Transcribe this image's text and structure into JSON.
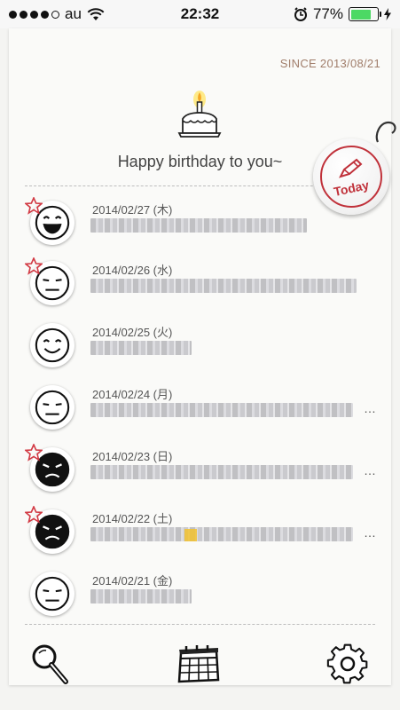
{
  "status_bar": {
    "carrier": "au",
    "time": "22:32",
    "battery": "77%",
    "battery_level": 0.77
  },
  "header": {
    "since": "SINCE 2013/08/21",
    "message": "Happy birthday to you~"
  },
  "today_button": {
    "label": "Today"
  },
  "entries": [
    {
      "date": "2014/02/27 (木)",
      "mood": "laugh",
      "starred": true,
      "text": "",
      "truncated": false
    },
    {
      "date": "2014/02/26 (水)",
      "mood": "meh",
      "starred": true,
      "text": "",
      "truncated": false
    },
    {
      "date": "2014/02/25 (火)",
      "mood": "smile",
      "starred": false,
      "text": "",
      "truncated": false
    },
    {
      "date": "2014/02/24 (月)",
      "mood": "meh",
      "starred": false,
      "text": "",
      "truncated": true
    },
    {
      "date": "2014/02/23 (日)",
      "mood": "angry",
      "starred": true,
      "text": "",
      "truncated": true
    },
    {
      "date": "2014/02/22 (土)",
      "mood": "angry",
      "starred": true,
      "text": "",
      "truncated": true
    },
    {
      "date": "2014/02/21 (金)",
      "mood": "meh",
      "starred": false,
      "text": "",
      "truncated": false
    }
  ],
  "toolbar": {
    "search_icon": "magnifier-icon",
    "calendar_icon": "calendar-icon",
    "settings_icon": "gear-icon"
  },
  "colors": {
    "accent": "#c0313a",
    "since_text": "#a07d6a",
    "battery": "#4cd964"
  },
  "ellipsis": "…"
}
